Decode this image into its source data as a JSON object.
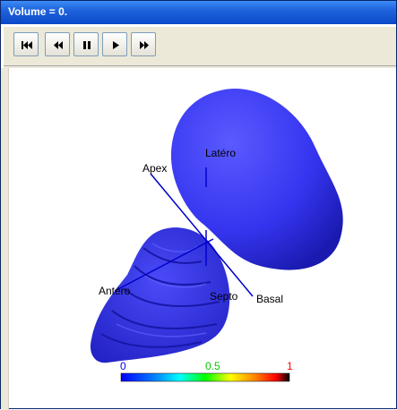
{
  "window": {
    "title": "Volume = 0."
  },
  "toolbar": {
    "buttons": [
      {
        "name": "first-frame-button",
        "icon": "skip-to-start-icon"
      },
      {
        "name": "rewind-button",
        "icon": "fast-backward-icon"
      },
      {
        "name": "pause-button",
        "icon": "pause-icon"
      },
      {
        "name": "play-button",
        "icon": "play-icon"
      },
      {
        "name": "fast-forward-button",
        "icon": "fast-forward-icon"
      }
    ]
  },
  "scene": {
    "labels": {
      "apex": "Apex",
      "latero": "Latéro",
      "antero": "Antéro",
      "septo": "Septo",
      "basal": "Basal"
    },
    "colors": {
      "surface": "#3a3af5",
      "axis": "#0000cc"
    }
  },
  "colorbar": {
    "ticks": [
      {
        "label": "0",
        "color": "#0000ff"
      },
      {
        "label": "0.5",
        "color": "#00c800"
      },
      {
        "label": "1",
        "color": "#ff0000"
      }
    ]
  }
}
